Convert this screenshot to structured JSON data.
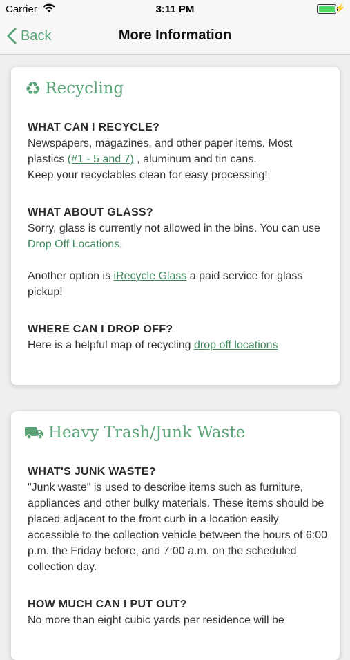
{
  "status_bar": {
    "carrier": "Carrier",
    "time": "3:11 PM"
  },
  "nav": {
    "back_label": "Back",
    "title": "More Information"
  },
  "recycling": {
    "title": "Recycling",
    "q1": "WHAT CAN I RECYCLE?",
    "a1_part1": "Newspapers, magazines, and other paper items. Most plastics ",
    "a1_link": "(#1 - 5 and 7)",
    "a1_part2": " , aluminum and tin cans.",
    "a1_part3": "Keep your recyclables clean for easy processing!",
    "q2": "WHAT ABOUT GLASS?",
    "a2_part1": "Sorry, glass is currently not allowed in the bins. You can use ",
    "a2_link": "Drop Off Locations",
    "a2_part2": ".",
    "a3_part1": "Another option is ",
    "a3_link": "iRecycle Glass",
    "a3_part2": " a paid service for glass pickup!",
    "q3": "WHERE CAN I DROP OFF?",
    "a4_part1": "Here is a helpful map of recycling ",
    "a4_link": "drop off locations"
  },
  "junk": {
    "title": "Heavy Trash/Junk Waste",
    "q1": "WHAT'S JUNK WASTE?",
    "a1": "\"Junk waste\" is used to describe items such as furniture, appliances and other bulky materials. These items should be placed adjacent to the front curb in a location easily accessible to the collection vehicle between the hours of 6:00 p.m. the Friday before, and 7:00 a.m. on the scheduled collection day.",
    "q2": "HOW MUCH CAN I PUT OUT?",
    "a2": "No more than eight cubic yards per residence will be"
  },
  "colors": {
    "accent": "#5aa477",
    "link": "#3f8a5c",
    "battery": "#4cd964"
  }
}
